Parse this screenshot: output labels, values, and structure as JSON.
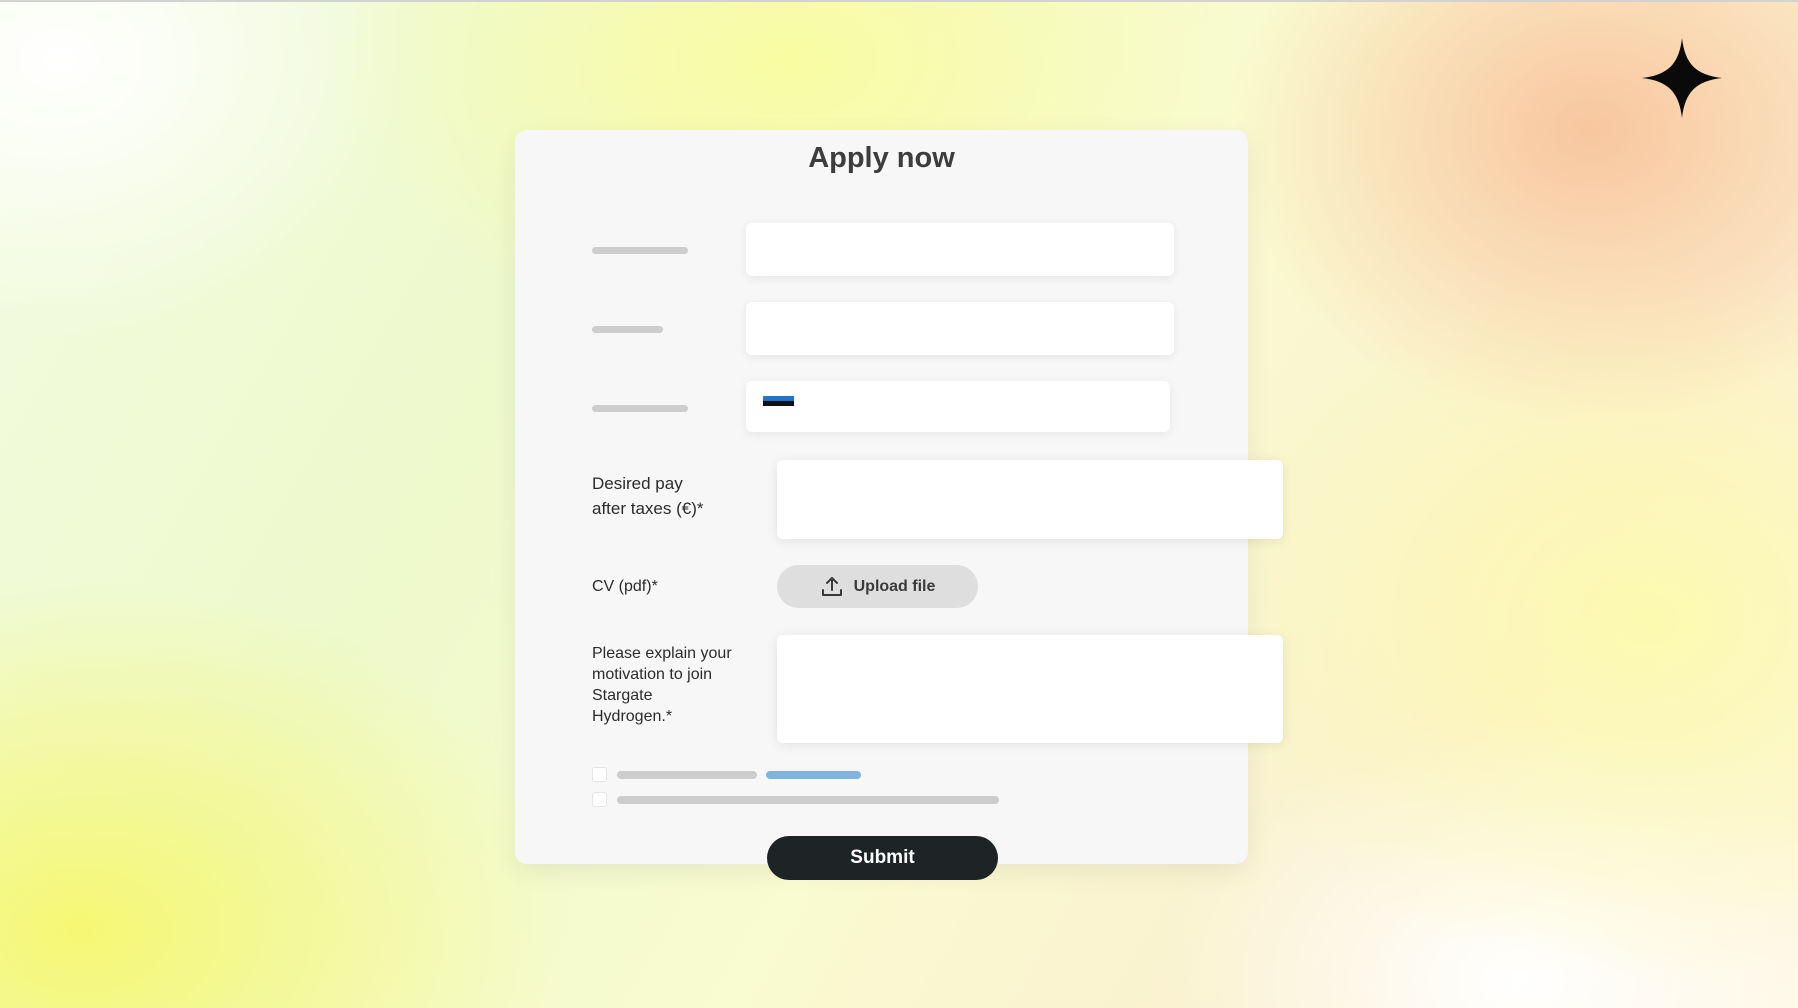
{
  "form": {
    "title": "Apply now",
    "fields": [
      {
        "id": "name",
        "label": "",
        "value": "",
        "placeholder": ""
      },
      {
        "id": "email",
        "label": "",
        "value": "",
        "placeholder": ""
      },
      {
        "id": "phone",
        "label": "",
        "value": "",
        "placeholder": "",
        "country_flag_icon": "estonia-flag-icon"
      },
      {
        "id": "desired-pay",
        "label": "Desired pay\nafter taxes (€)*",
        "value": "",
        "placeholder": ""
      },
      {
        "id": "cv",
        "label": "CV (pdf)*",
        "button_label": "Upload file",
        "icon": "upload-icon"
      },
      {
        "id": "motivation",
        "label": "Please explain your\nmotivation to join\nStargate\nHydrogen.*",
        "value": "",
        "placeholder": ""
      }
    ],
    "consents": [
      {
        "checked": false
      },
      {
        "checked": false
      }
    ],
    "submit_label": "Submit"
  },
  "brand": {
    "icon": "four-point-star-icon"
  },
  "colors": {
    "card_background": "#f7f7f7",
    "submit_background": "#1e2326",
    "link_accent": "#7fb5dc",
    "skeleton": "#cdcdcd"
  }
}
